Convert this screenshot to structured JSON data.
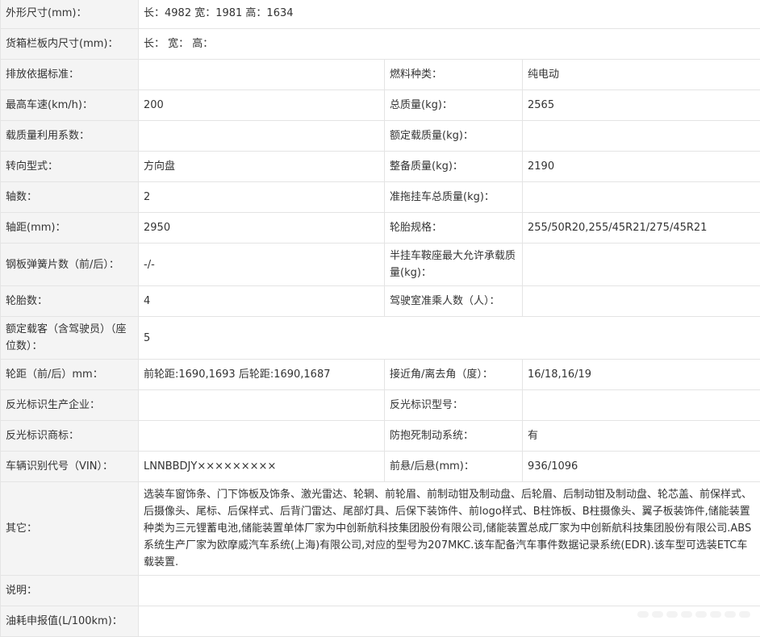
{
  "rows": {
    "dims": {
      "label": "外形尺寸(mm)：",
      "value": "长：4982 宽：1981 高：1634"
    },
    "cargo": {
      "label": "货箱栏板内尺寸(mm)：",
      "value": "长：  宽：  高："
    },
    "emission": {
      "label": "排放依据标准：",
      "value": "",
      "label2": "燃料种类：",
      "value2": "纯电动"
    },
    "speed": {
      "label": "最高车速(km/h)：",
      "value": "200",
      "label2": "总质量(kg)：",
      "value2": "2565"
    },
    "loadfactor": {
      "label": "载质量利用系数：",
      "value": "",
      "label2": "额定载质量(kg)：",
      "value2": ""
    },
    "steering": {
      "label": "转向型式：",
      "value": "方向盘",
      "label2": "整备质量(kg)：",
      "value2": "2190"
    },
    "axles": {
      "label": "轴数：",
      "value": "2",
      "label2": "准拖挂车总质量(kg)：",
      "value2": ""
    },
    "wheelbase": {
      "label": "轴距(mm)：",
      "value": "2950",
      "label2": "轮胎规格：",
      "value2": "255/50R20,255/45R21/275/45R21"
    },
    "springs": {
      "label": "钢板弹簧片数（前/后）：",
      "value": "-/-",
      "label2": "半挂车鞍座最大允许承载质量(kg)：",
      "value2": ""
    },
    "tires": {
      "label": "轮胎数：",
      "value": "4",
      "label2": "驾驶室准乘人数（人）：",
      "value2": ""
    },
    "passengers": {
      "label": "额定载客（含驾驶员）（座位数）：",
      "value": "5"
    },
    "track": {
      "label": "轮距（前/后）mm：",
      "value": "前轮距:1690,1693 后轮距:1690,1687",
      "label2": "接近角/离去角（度）：",
      "value2": "16/18,16/19"
    },
    "reflector_maker": {
      "label": "反光标识生产企业：",
      "value": "",
      "label2": "反光标识型号：",
      "value2": ""
    },
    "reflector_brand": {
      "label": "反光标识商标：",
      "value": "",
      "label2": "防抱死制动系统：",
      "value2": "有"
    },
    "vin": {
      "label": "车辆识别代号（VIN）：",
      "value": "LNNBBDJY×××××××××",
      "label2": "前悬/后悬(mm)：",
      "value2": "936/1096"
    },
    "other": {
      "label": "其它：",
      "value": "选装车窗饰条、门下饰板及饰条、激光雷达、轮辋、前轮眉、前制动钳及制动盘、后轮眉、后制动钳及制动盘、轮芯盖、前保样式、后摄像头、尾标、后保样式、后背门雷达、尾部灯具、后保下装饰件、前logo样式、B柱饰板、B柱摄像头、翼子板装饰件,储能装置种类为三元锂蓄电池,储能装置单体厂家为中创新航科技集团股份有限公司,储能装置总成厂家为中创新航科技集团股份有限公司.ABS系统生产厂家为欧摩威汽车系统(上海)有限公司,对应的型号为207MKC.该车配备汽车事件数据记录系统(EDR).该车型可选装ETC车载装置."
    },
    "note": {
      "label": "说明：",
      "value": ""
    },
    "fuel": {
      "label": "油耗申报值(L/100km)：",
      "value": ""
    }
  }
}
